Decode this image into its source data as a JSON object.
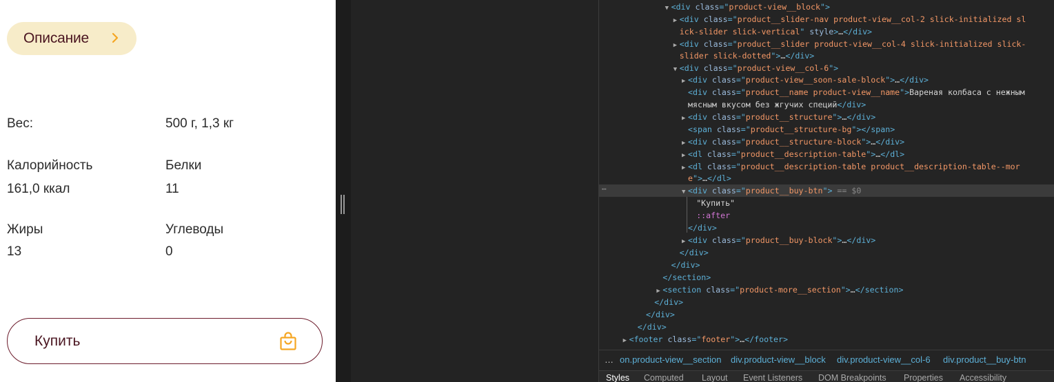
{
  "product": {
    "description_button": "Описание",
    "weight_label": "Вес:",
    "weight_value": "500 г, 1,3 кг",
    "calories_label": "Калорийность",
    "calories_value": "161,0 ккал",
    "protein_label": "Белки",
    "protein_value": "11",
    "fat_label": "Жиры",
    "fat_value": "13",
    "carbs_label": "Углеводы",
    "carbs_value": "0",
    "buy_label": "Купить",
    "icons": {
      "description_arrow": "chevron-right-icon",
      "buy": "shopping-bag-icon"
    },
    "colors": {
      "accent": "#f5a623",
      "brand_text": "#4a1520",
      "pill_bg": "#f7ecc9",
      "border": "#6b1a2a"
    }
  },
  "devtools": {
    "tree_lines": [
      {
        "indent": 8,
        "tri": "▼",
        "parts": [
          [
            "t",
            "<div "
          ],
          [
            "a",
            "class"
          ],
          [
            "t",
            "=\""
          ],
          [
            "v",
            "product-view__block"
          ],
          [
            "t",
            "\">"
          ]
        ]
      },
      {
        "indent": 9,
        "tri": "▶",
        "parts": [
          [
            "t",
            "<div "
          ],
          [
            "a",
            "class"
          ],
          [
            "t",
            "=\""
          ],
          [
            "v",
            "product__slider-nav product-view__col-2 slick-initialized sl"
          ]
        ]
      },
      {
        "indent": 9,
        "tri": "",
        "parts": [
          [
            "v",
            "ick-slider slick-vertical"
          ],
          [
            "t",
            "\" "
          ],
          [
            "a",
            "style"
          ],
          [
            "t",
            ">"
          ],
          [
            "s",
            "…"
          ],
          [
            "t",
            "</div>"
          ]
        ]
      },
      {
        "indent": 9,
        "tri": "▶",
        "parts": [
          [
            "t",
            "<div "
          ],
          [
            "a",
            "class"
          ],
          [
            "t",
            "=\""
          ],
          [
            "v",
            "product__slider product-view__col-4 slick-initialized slick-"
          ]
        ]
      },
      {
        "indent": 9,
        "tri": "",
        "parts": [
          [
            "v",
            "slider slick-dotted"
          ],
          [
            "t",
            "\">"
          ],
          [
            "s",
            "…"
          ],
          [
            "t",
            "</div>"
          ]
        ]
      },
      {
        "indent": 9,
        "tri": "▼",
        "parts": [
          [
            "t",
            "<div "
          ],
          [
            "a",
            "class"
          ],
          [
            "t",
            "=\""
          ],
          [
            "v",
            "product-view__col-6"
          ],
          [
            "t",
            "\">"
          ]
        ]
      },
      {
        "indent": 10,
        "tri": "▶",
        "parts": [
          [
            "t",
            "<div "
          ],
          [
            "a",
            "class"
          ],
          [
            "t",
            "=\""
          ],
          [
            "v",
            "product-view__soon-sale-block"
          ],
          [
            "t",
            "\">"
          ],
          [
            "s",
            "…"
          ],
          [
            "t",
            "</div>"
          ]
        ]
      },
      {
        "indent": 10,
        "tri": " ",
        "parts": [
          [
            "t",
            "<div "
          ],
          [
            "a",
            "class"
          ],
          [
            "t",
            "=\""
          ],
          [
            "v",
            "product__name product-view__name"
          ],
          [
            "t",
            "\">"
          ],
          [
            "s",
            "Вареная колбаса с нежным"
          ]
        ]
      },
      {
        "indent": 10,
        "tri": " ",
        "parts": [
          [
            "s",
            "мясным вкусом без жгучих специй"
          ],
          [
            "t",
            "</div>"
          ]
        ]
      },
      {
        "indent": 10,
        "tri": "▶",
        "parts": [
          [
            "t",
            "<div "
          ],
          [
            "a",
            "class"
          ],
          [
            "t",
            "=\""
          ],
          [
            "v",
            "product__structure"
          ],
          [
            "t",
            "\">"
          ],
          [
            "s",
            "…"
          ],
          [
            "t",
            "</div>"
          ]
        ]
      },
      {
        "indent": 10,
        "tri": " ",
        "parts": [
          [
            "t",
            "<span "
          ],
          [
            "a",
            "class"
          ],
          [
            "t",
            "=\""
          ],
          [
            "v",
            "product__structure-bg"
          ],
          [
            "t",
            "\"></span>"
          ]
        ]
      },
      {
        "indent": 10,
        "tri": "▶",
        "parts": [
          [
            "t",
            "<div "
          ],
          [
            "a",
            "class"
          ],
          [
            "t",
            "=\""
          ],
          [
            "v",
            "product__structure-block"
          ],
          [
            "t",
            "\">"
          ],
          [
            "s",
            "…"
          ],
          [
            "t",
            "</div>"
          ]
        ]
      },
      {
        "indent": 10,
        "tri": "▶",
        "parts": [
          [
            "t",
            "<dl "
          ],
          [
            "a",
            "class"
          ],
          [
            "t",
            "=\""
          ],
          [
            "v",
            "product__description-table"
          ],
          [
            "t",
            "\">"
          ],
          [
            "s",
            "…"
          ],
          [
            "t",
            "</dl>"
          ]
        ]
      },
      {
        "indent": 10,
        "tri": "▶",
        "parts": [
          [
            "t",
            "<dl "
          ],
          [
            "a",
            "class"
          ],
          [
            "t",
            "=\""
          ],
          [
            "v",
            "product__description-table product__description-table--mor"
          ]
        ]
      },
      {
        "indent": 10,
        "tri": " ",
        "parts": [
          [
            "v",
            "e"
          ],
          [
            "t",
            "\">"
          ],
          [
            "s",
            "…"
          ],
          [
            "t",
            "</dl>"
          ]
        ]
      },
      {
        "indent": 10,
        "tri": "▼",
        "sel": true,
        "parts": [
          [
            "t",
            "<div "
          ],
          [
            "a",
            "class"
          ],
          [
            "t",
            "=\""
          ],
          [
            "v",
            "product__buy-btn"
          ],
          [
            "t",
            "\">"
          ],
          [
            "eq",
            " == $0"
          ]
        ]
      },
      {
        "indent": 11,
        "tri": " ",
        "parts": [
          [
            "s",
            "\"Купить\""
          ]
        ]
      },
      {
        "indent": 11,
        "tri": " ",
        "parts": [
          [
            "ps",
            "::after"
          ]
        ]
      },
      {
        "indent": 10,
        "tri": " ",
        "parts": [
          [
            "t",
            "</div>"
          ]
        ]
      },
      {
        "indent": 10,
        "tri": "▶",
        "parts": [
          [
            "t",
            "<div "
          ],
          [
            "a",
            "class"
          ],
          [
            "t",
            "=\""
          ],
          [
            "v",
            "product__buy-block"
          ],
          [
            "t",
            "\">"
          ],
          [
            "s",
            "…"
          ],
          [
            "t",
            "</div>"
          ]
        ]
      },
      {
        "indent": 9,
        "tri": " ",
        "parts": [
          [
            "t",
            "</div>"
          ]
        ]
      },
      {
        "indent": 8,
        "tri": " ",
        "parts": [
          [
            "t",
            "</div>"
          ]
        ]
      },
      {
        "indent": 7,
        "tri": " ",
        "parts": [
          [
            "t",
            "</section>"
          ]
        ]
      },
      {
        "indent": 7,
        "tri": "▶",
        "parts": [
          [
            "t",
            "<section "
          ],
          [
            "a",
            "class"
          ],
          [
            "t",
            "=\""
          ],
          [
            "v",
            "product-more__section"
          ],
          [
            "t",
            "\">"
          ],
          [
            "s",
            "…"
          ],
          [
            "t",
            "</section>"
          ]
        ]
      },
      {
        "indent": 6,
        "tri": " ",
        "parts": [
          [
            "t",
            "</div>"
          ]
        ]
      },
      {
        "indent": 5,
        "tri": " ",
        "parts": [
          [
            "t",
            "</div>"
          ]
        ]
      },
      {
        "indent": 4,
        "tri": " ",
        "parts": [
          [
            "t",
            "</div>"
          ]
        ]
      },
      {
        "indent": 3,
        "tri": "▶",
        "parts": [
          [
            "t",
            "<footer "
          ],
          [
            "a",
            "class"
          ],
          [
            "t",
            "=\""
          ],
          [
            "v",
            "footer"
          ],
          [
            "t",
            "\">"
          ],
          [
            "s",
            "…"
          ],
          [
            "t",
            "</footer>"
          ]
        ]
      }
    ],
    "breadcrumbs": {
      "more": "…",
      "items": [
        {
          "prefix": "",
          "rest": "on.product-view__section"
        },
        {
          "prefix": "div",
          "rest": ".product-view__block"
        },
        {
          "prefix": "div",
          "rest": ".product-view__col-6"
        },
        {
          "prefix": "div",
          "rest": ".product__buy-btn"
        }
      ]
    },
    "tabs": [
      "Styles",
      "Computed",
      "Layout",
      "Event Listeners",
      "DOM Breakpoints",
      "Properties",
      "Accessibility"
    ],
    "active_tab": "Styles"
  }
}
